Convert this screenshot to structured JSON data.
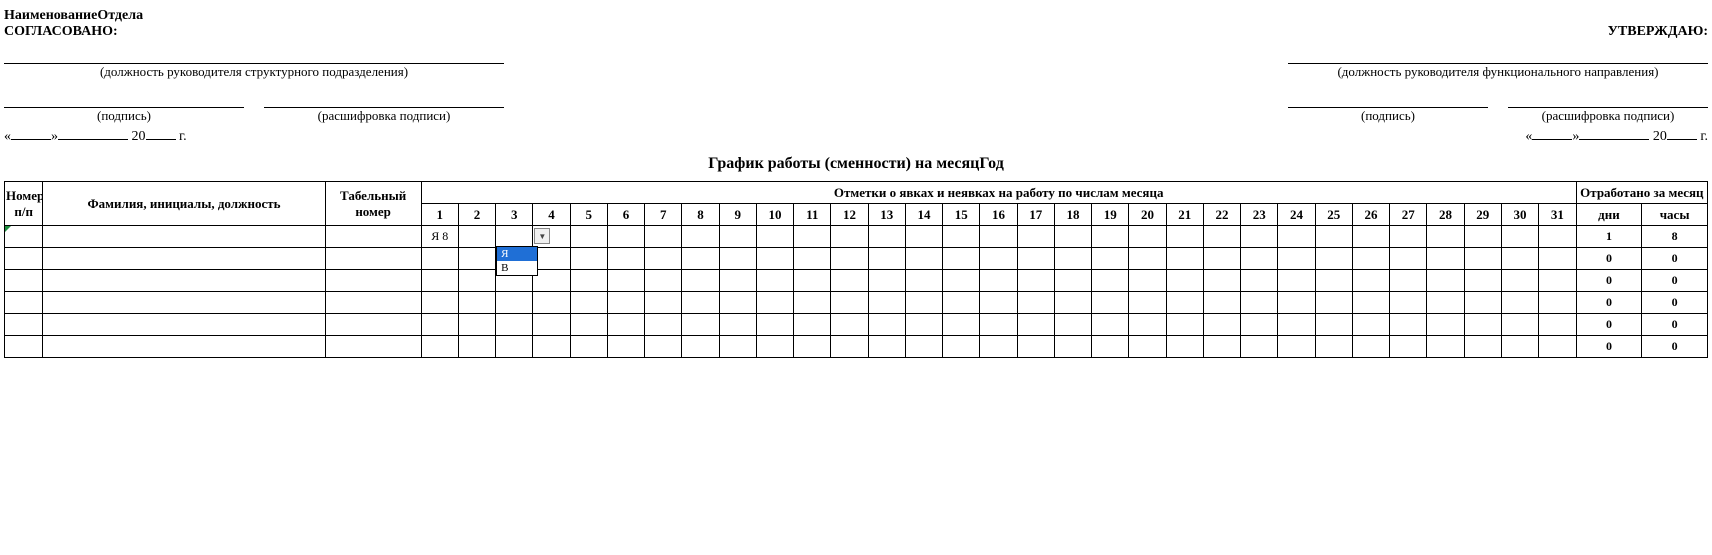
{
  "header": {
    "department": "НаименованиеОтдела",
    "agreed": "СОГЛАСОВАНО:",
    "approve": "УТВЕРЖДАЮ:",
    "sig_left_caption": "(должность руководителя структурного подразделения)",
    "sig_right_caption": "(должность руководителя функционального направления)",
    "signature_caption": "(подпись)",
    "decipher_caption": "(расшифровка подписи)",
    "date_prefix": "«",
    "date_mid": "»",
    "year_prefix": "20",
    "year_suffix": "г.",
    "title": "График работы (сменности) на месяцГод"
  },
  "table": {
    "col_num": "Номер п/п",
    "col_name": "Фамилия, инициалы, должность",
    "col_tab": "Табельный номер",
    "marks_header": "Отметки о явках и неявках на работу по числам месяца",
    "days": [
      "1",
      "2",
      "3",
      "4",
      "5",
      "6",
      "7",
      "8",
      "9",
      "10",
      "11",
      "12",
      "13",
      "14",
      "15",
      "16",
      "17",
      "18",
      "19",
      "20",
      "21",
      "22",
      "23",
      "24",
      "25",
      "26",
      "27",
      "28",
      "29",
      "30",
      "31"
    ],
    "worked_header": "Отработано за месяц",
    "worked_days": "дни",
    "worked_hours": "часы"
  },
  "rows": [
    {
      "num": "",
      "name": "",
      "tab": "",
      "cells": [
        "Я 8",
        "",
        "",
        "",
        "",
        "",
        "",
        "",
        "",
        "",
        "",
        "",
        "",
        "",
        "",
        "",
        "",
        "",
        "",
        "",
        "",
        "",
        "",
        "",
        "",
        "",
        "",
        "",
        "",
        "",
        ""
      ],
      "days": "1",
      "hours": "8"
    },
    {
      "num": "",
      "name": "",
      "tab": "",
      "cells": [
        "",
        "",
        "",
        "",
        "",
        "",
        "",
        "",
        "",
        "",
        "",
        "",
        "",
        "",
        "",
        "",
        "",
        "",
        "",
        "",
        "",
        "",
        "",
        "",
        "",
        "",
        "",
        "",
        "",
        "",
        ""
      ],
      "days": "0",
      "hours": "0"
    },
    {
      "num": "",
      "name": "",
      "tab": "",
      "cells": [
        "",
        "",
        "",
        "",
        "",
        "",
        "",
        "",
        "",
        "",
        "",
        "",
        "",
        "",
        "",
        "",
        "",
        "",
        "",
        "",
        "",
        "",
        "",
        "",
        "",
        "",
        "",
        "",
        "",
        "",
        ""
      ],
      "days": "0",
      "hours": "0"
    },
    {
      "num": "",
      "name": "",
      "tab": "",
      "cells": [
        "",
        "",
        "",
        "",
        "",
        "",
        "",
        "",
        "",
        "",
        "",
        "",
        "",
        "",
        "",
        "",
        "",
        "",
        "",
        "",
        "",
        "",
        "",
        "",
        "",
        "",
        "",
        "",
        "",
        "",
        ""
      ],
      "days": "0",
      "hours": "0"
    },
    {
      "num": "",
      "name": "",
      "tab": "",
      "cells": [
        "",
        "",
        "",
        "",
        "",
        "",
        "",
        "",
        "",
        "",
        "",
        "",
        "",
        "",
        "",
        "",
        "",
        "",
        "",
        "",
        "",
        "",
        "",
        "",
        "",
        "",
        "",
        "",
        "",
        "",
        ""
      ],
      "days": "0",
      "hours": "0"
    },
    {
      "num": "",
      "name": "",
      "tab": "",
      "cells": [
        "",
        "",
        "",
        "",
        "",
        "",
        "",
        "",
        "",
        "",
        "",
        "",
        "",
        "",
        "",
        "",
        "",
        "",
        "",
        "",
        "",
        "",
        "",
        "",
        "",
        "",
        "",
        "",
        "",
        "",
        ""
      ],
      "days": "0",
      "hours": "0"
    }
  ],
  "dropdown": {
    "options": [
      "Я",
      "В"
    ],
    "selected_index": 0
  }
}
